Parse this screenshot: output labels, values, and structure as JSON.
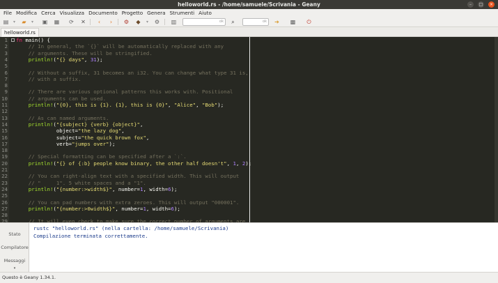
{
  "window": {
    "title": "helloworld.rs - /home/samuele/Scrivania - Geany",
    "minimize_icon": "–",
    "maximize_icon": "□",
    "close_icon": "×"
  },
  "menu": [
    "File",
    "Modifica",
    "Cerca",
    "Visualizza",
    "Documento",
    "Progetto",
    "Genera",
    "Strumenti",
    "Aiuto"
  ],
  "toolbar": {
    "search_placeholder": "",
    "goto_placeholder": ""
  },
  "tab": {
    "label": "helloworld.rs"
  },
  "colors": {
    "comment": "#75715e",
    "keyword": "#f92672",
    "string": "#e6db74",
    "number": "#ae81ff",
    "plain": "#f8f8f2",
    "macro": "#a6e22e"
  },
  "code_lines": [
    {
      "n": "1",
      "tokens": [
        [
          "fn ",
          "keyword"
        ],
        [
          "main() {",
          "plain"
        ]
      ]
    },
    {
      "n": "2",
      "tokens": [
        [
          "    // In general, the `{}` will be automatically replaced with any",
          "comment"
        ]
      ]
    },
    {
      "n": "3",
      "tokens": [
        [
          "    // arguments. These will be stringified.",
          "comment"
        ]
      ]
    },
    {
      "n": "4",
      "tokens": [
        [
          "    println!",
          "macro"
        ],
        [
          "(",
          "plain"
        ],
        [
          "\"{} days\"",
          "string"
        ],
        [
          ", ",
          "plain"
        ],
        [
          "31",
          "number"
        ],
        [
          ");",
          "plain"
        ]
      ]
    },
    {
      "n": "5",
      "tokens": [
        [
          "",
          "plain"
        ]
      ]
    },
    {
      "n": "6",
      "tokens": [
        [
          "    // Without a suffix, 31 becomes an i32. You can change what type 31 is,",
          "comment"
        ]
      ]
    },
    {
      "n": "7",
      "tokens": [
        [
          "    // with a suffix.",
          "comment"
        ]
      ]
    },
    {
      "n": "8",
      "tokens": [
        [
          "",
          "plain"
        ]
      ]
    },
    {
      "n": "9",
      "tokens": [
        [
          "    // There are various optional patterns this works with. Positional",
          "comment"
        ]
      ]
    },
    {
      "n": "10",
      "tokens": [
        [
          "    // arguments can be used.",
          "comment"
        ]
      ]
    },
    {
      "n": "11",
      "tokens": [
        [
          "    println!",
          "macro"
        ],
        [
          "(",
          "plain"
        ],
        [
          "\"{0}, this is {1}. {1}, this is {0}\"",
          "string"
        ],
        [
          ", ",
          "plain"
        ],
        [
          "\"Alice\"",
          "string"
        ],
        [
          ", ",
          "plain"
        ],
        [
          "\"Bob\"",
          "string"
        ],
        [
          ");",
          "plain"
        ]
      ]
    },
    {
      "n": "12",
      "tokens": [
        [
          "",
          "plain"
        ]
      ]
    },
    {
      "n": "13",
      "tokens": [
        [
          "    // As can named arguments.",
          "comment"
        ]
      ]
    },
    {
      "n": "14",
      "tokens": [
        [
          "    println!",
          "macro"
        ],
        [
          "(",
          "plain"
        ],
        [
          "\"{subject} {verb} {object}\"",
          "string"
        ],
        [
          ",",
          "plain"
        ]
      ]
    },
    {
      "n": "15",
      "tokens": [
        [
          "             object=",
          "plain"
        ],
        [
          "\"the lazy dog\"",
          "string"
        ],
        [
          ",",
          "plain"
        ]
      ]
    },
    {
      "n": "16",
      "tokens": [
        [
          "             subject=",
          "plain"
        ],
        [
          "\"the quick brown fox\"",
          "string"
        ],
        [
          ",",
          "plain"
        ]
      ]
    },
    {
      "n": "17",
      "tokens": [
        [
          "             verb=",
          "plain"
        ],
        [
          "\"jumps over\"",
          "string"
        ],
        [
          ");",
          "plain"
        ]
      ]
    },
    {
      "n": "18",
      "tokens": [
        [
          "",
          "plain"
        ]
      ]
    },
    {
      "n": "19",
      "tokens": [
        [
          "    // Special formatting can be specified after a `:`.",
          "comment"
        ]
      ]
    },
    {
      "n": "20",
      "tokens": [
        [
          "    println!",
          "macro"
        ],
        [
          "(",
          "plain"
        ],
        [
          "\"{} of {:b} people know binary, the other half doesn't\"",
          "string"
        ],
        [
          ", ",
          "plain"
        ],
        [
          "1",
          "number"
        ],
        [
          ", ",
          "plain"
        ],
        [
          "2",
          "number"
        ],
        [
          ");",
          "plain"
        ]
      ]
    },
    {
      "n": "21",
      "tokens": [
        [
          "",
          "plain"
        ]
      ]
    },
    {
      "n": "22",
      "tokens": [
        [
          "    // You can right-align text with a specified width. This will output",
          "comment"
        ]
      ]
    },
    {
      "n": "23",
      "tokens": [
        [
          "    // \"     1\". 5 white spaces and a \"1\".",
          "comment"
        ]
      ]
    },
    {
      "n": "24",
      "tokens": [
        [
          "    println!",
          "macro"
        ],
        [
          "(",
          "plain"
        ],
        [
          "\"{number:>width$}\"",
          "string"
        ],
        [
          ", number=",
          "plain"
        ],
        [
          "1",
          "number"
        ],
        [
          ", width=",
          "plain"
        ],
        [
          "6",
          "number"
        ],
        [
          ");",
          "plain"
        ]
      ]
    },
    {
      "n": "25",
      "tokens": [
        [
          "",
          "plain"
        ]
      ]
    },
    {
      "n": "26",
      "tokens": [
        [
          "    // You can pad numbers with extra zeroes. This will output \"000001\".",
          "comment"
        ]
      ]
    },
    {
      "n": "27",
      "tokens": [
        [
          "    println!",
          "macro"
        ],
        [
          "(",
          "plain"
        ],
        [
          "\"{number:>0width$}\"",
          "string"
        ],
        [
          ", number=",
          "plain"
        ],
        [
          "1",
          "number"
        ],
        [
          ", width=",
          "plain"
        ],
        [
          "6",
          "number"
        ],
        [
          ");",
          "plain"
        ]
      ]
    },
    {
      "n": "28",
      "tokens": [
        [
          "",
          "plain"
        ]
      ]
    },
    {
      "n": "29",
      "tokens": [
        [
          "    // It will even check to make sure the correct number of arguments are",
          "comment"
        ]
      ]
    }
  ],
  "messages": {
    "tabs": [
      "Stato",
      "Compilatore",
      "Messaggi"
    ],
    "lines": [
      "rustc \"helloworld.rs\" (nella cartella: /home/samuele/Scrivania)",
      "Compilazione terminata correttamente."
    ]
  },
  "status": {
    "text": "Questo è Geany 1.34.1."
  }
}
